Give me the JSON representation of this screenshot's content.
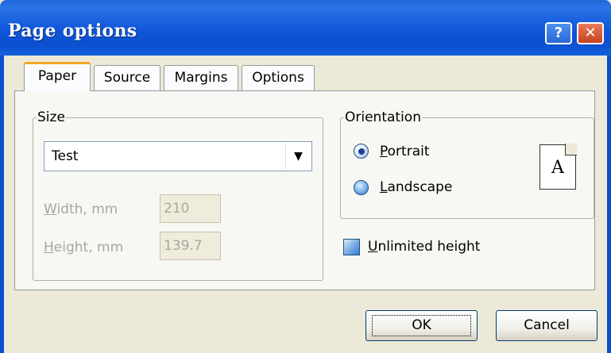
{
  "window": {
    "title": "Page options",
    "help_glyph": "?",
    "close_glyph": "✕"
  },
  "tabs": [
    {
      "label": "Paper",
      "active": true
    },
    {
      "label": "Source",
      "active": false
    },
    {
      "label": "Margins",
      "active": false
    },
    {
      "label": "Options",
      "active": false
    }
  ],
  "size": {
    "legend": "Size",
    "selected": "Test",
    "width_label_first": "W",
    "width_label_rest": "idth, mm",
    "width_value": "210",
    "height_label_first": "H",
    "height_label_rest": "eight, mm",
    "height_value": "139.7"
  },
  "orientation": {
    "legend": "Orientation",
    "portrait_first": "P",
    "portrait_rest": "ortrait",
    "portrait_selected": true,
    "landscape_first": "L",
    "landscape_rest": "andscape",
    "landscape_selected": false,
    "preview_glyph": "A"
  },
  "unlimited_height": {
    "label_first": "U",
    "label_rest": "nlimited height",
    "checked": false
  },
  "buttons": {
    "ok": "OK",
    "cancel": "Cancel"
  },
  "colors": {
    "title_bar": "#0b4fce",
    "dialog_bg": "#ece9d8",
    "active_tab_accent": "#f5a623"
  },
  "icons": [
    "help-icon",
    "close-icon",
    "dropdown-arrow-icon",
    "page-portrait-icon"
  ]
}
